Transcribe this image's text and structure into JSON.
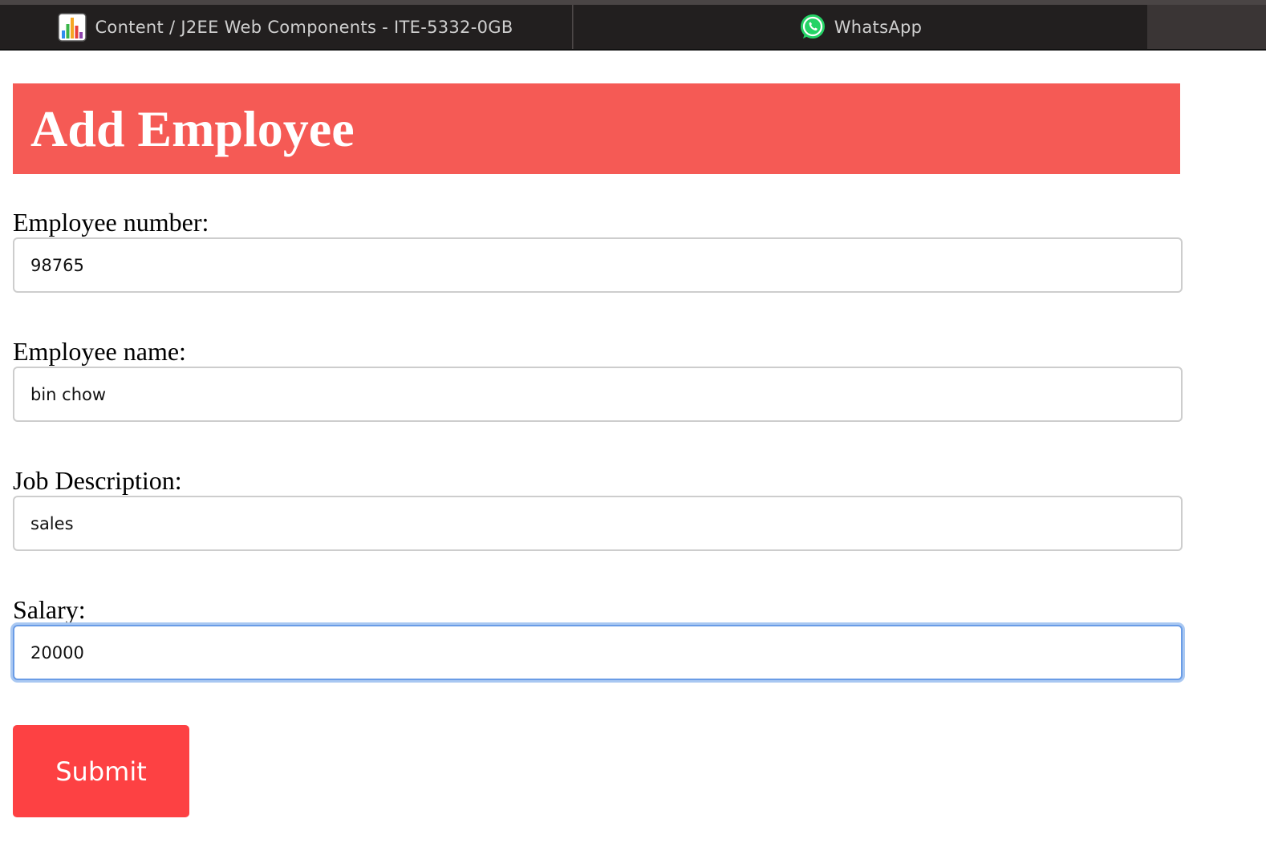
{
  "browser": {
    "tabs": [
      {
        "title": "Content / J2EE Web Components - ITE-5332-0GB",
        "icon": "bar-chart-icon"
      },
      {
        "title": "WhatsApp",
        "icon": "whatsapp-icon"
      }
    ]
  },
  "form": {
    "title": "Add Employee",
    "header_color": "#f55a55",
    "fields": [
      {
        "label": "Employee number:",
        "value": "98765"
      },
      {
        "label": "Employee name:",
        "value": "bin chow"
      },
      {
        "label": "Job Description:",
        "value": "sales"
      },
      {
        "label": "Salary:",
        "value": "20000",
        "focused": true
      }
    ],
    "submit_label": "Submit",
    "submit_color": "#fd4143"
  }
}
